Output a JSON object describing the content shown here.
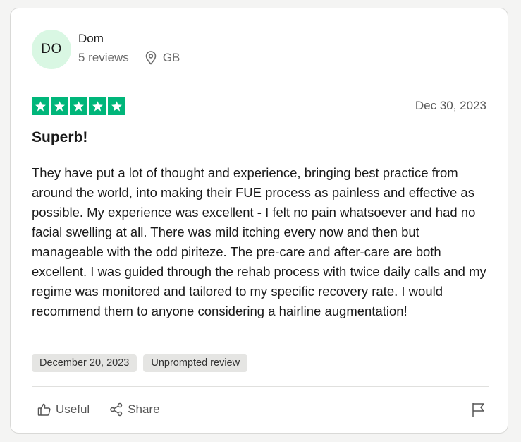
{
  "reviewer": {
    "initials": "DO",
    "name": "Dom",
    "reviews_count": "5 reviews",
    "country": "GB"
  },
  "review": {
    "rating": 5,
    "rating_max": 5,
    "date": "Dec 30, 2023",
    "title": "Superb!",
    "body": "They have put a lot of thought and experience, bringing best practice from around the world, into making their FUE process as painless and effective as possible. My experience was excellent - I felt no pain whatsoever and had no facial swelling at all. There was mild itching every now and then but manageable with the odd piriteze. The pre-care and after-care are both excellent. I was guided through the rehab process with twice daily calls and my regime was monitored and tailored to my specific recovery rate. I would recommend them to anyone considering a hairline augmentation!",
    "tags": [
      "December 20, 2023",
      "Unprompted review"
    ]
  },
  "actions": {
    "useful_label": "Useful",
    "share_label": "Share"
  },
  "colors": {
    "star_green": "#00b67a",
    "avatar_bg": "#d9f7e3"
  },
  "icons": {
    "location": "location-pin-icon",
    "star": "star-icon",
    "useful": "thumbs-up-icon",
    "share": "share-icon",
    "report": "flag-icon"
  }
}
